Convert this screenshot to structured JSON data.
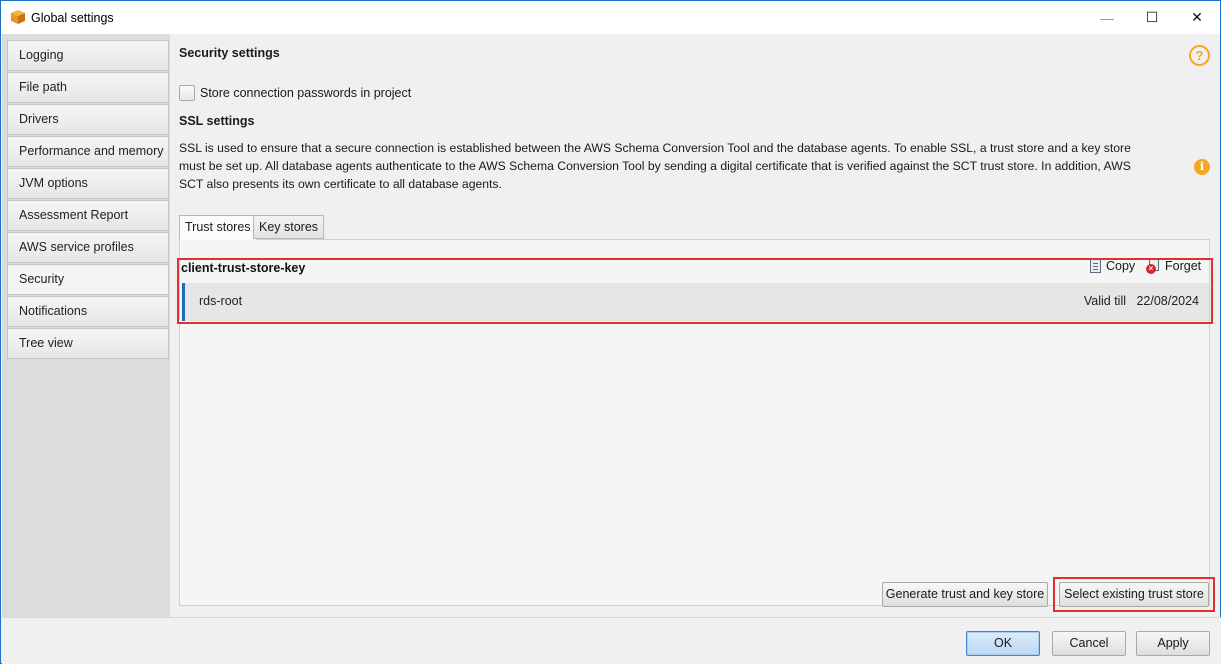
{
  "window": {
    "title": "Global settings",
    "minimize_glyph": "—",
    "maximize_glyph": "☐",
    "close_glyph": "✕"
  },
  "sidebar": {
    "items": [
      {
        "label": "Logging"
      },
      {
        "label": "File path"
      },
      {
        "label": "Drivers"
      },
      {
        "label": "Performance and memory"
      },
      {
        "label": "JVM options"
      },
      {
        "label": "Assessment Report"
      },
      {
        "label": "AWS service profiles"
      },
      {
        "label": "Security",
        "selected": true
      },
      {
        "label": "Notifications"
      },
      {
        "label": "Tree view"
      }
    ]
  },
  "main": {
    "section_title": "Security settings",
    "help_glyph": "?",
    "store_passwords_label": "Store connection passwords in project",
    "store_passwords_checked": false,
    "ssl_title": "SSL settings",
    "ssl_description": "SSL is used to ensure that a secure connection is established between the AWS Schema Conversion Tool and the database agents. To enable SSL, a trust store and a key store must be set up. All database agents authenticate to the AWS Schema Conversion Tool by sending a digital certificate that is verified against the SCT trust store. In addition, AWS SCT also presents its own certificate to all database agents.",
    "info_glyph": "i",
    "tabs": [
      {
        "label": "Trust stores",
        "active": true
      },
      {
        "label": "Key stores",
        "active": false
      }
    ],
    "trust_store": {
      "name": "client-trust-store-key",
      "copy_label": "Copy",
      "forget_label": "Forget",
      "forget_glyph": "×",
      "certificate": {
        "name": "rds-root",
        "valid_label": "Valid till",
        "valid_date": "22/08/2024"
      }
    },
    "generate_button": "Generate trust and key store",
    "select_button": "Select existing trust store"
  },
  "footer": {
    "ok": "OK",
    "cancel": "Cancel",
    "apply": "Apply"
  },
  "colors": {
    "accent": "#1e6fb8",
    "highlight": "#e03030",
    "warning_icon": "#f5a623"
  }
}
